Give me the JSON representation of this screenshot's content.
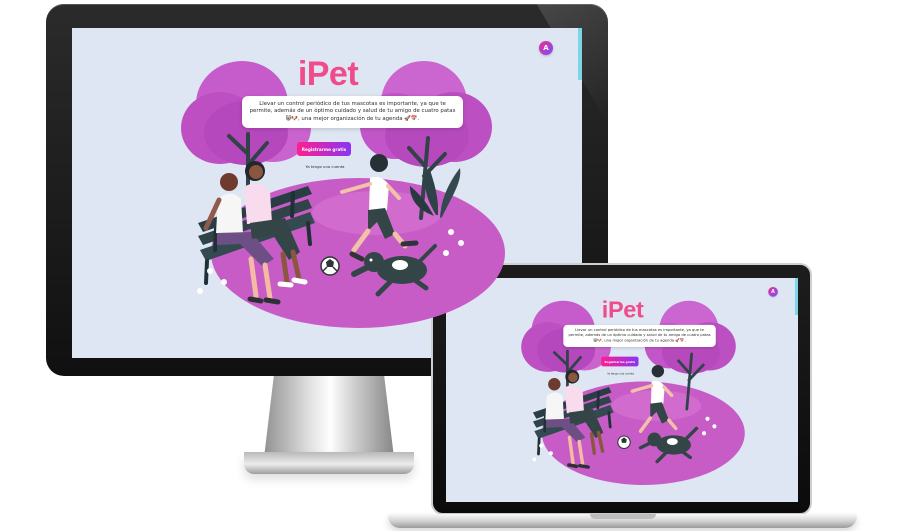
{
  "app": {
    "title": "iPet",
    "translate_icon": "translate-icon",
    "translate_label": "A",
    "intro_text": "Llevar un control periódico de tus mascotas es importante, ya que te permite, además de un óptimo cuidado y salud de tu amigo de cuatro patas 😸🐶, una mejor organización de tu agenda 🚀📅.",
    "register_label": "Registrarme gratis",
    "account_link": "Ya tengo una cuenta",
    "colors": {
      "background": "#dde6f2",
      "brand_pink": "#f04b8b",
      "park_purple": "#c85cc7",
      "button_start": "#ff1f8f",
      "button_end": "#8a35f2"
    }
  },
  "devices": {
    "monitor_icon": "desktop-monitor-icon",
    "laptop_icon": "laptop-icon"
  }
}
